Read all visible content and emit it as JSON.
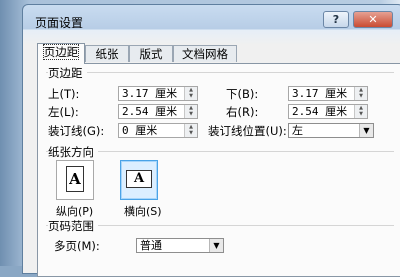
{
  "dialog": {
    "title": "页面设置",
    "help_glyph": "?",
    "close_glyph": "✕"
  },
  "tabs": [
    {
      "label": "页边距",
      "active": true
    },
    {
      "label": "纸张",
      "active": false
    },
    {
      "label": "版式",
      "active": false
    },
    {
      "label": "文档网格",
      "active": false
    }
  ],
  "margins": {
    "section_label": "页边距",
    "top": {
      "label": "上(T):",
      "value": "3.17 厘米"
    },
    "bottom": {
      "label": "下(B):",
      "value": "3.17 厘米"
    },
    "left": {
      "label": "左(L):",
      "value": "2.54 厘米"
    },
    "right": {
      "label": "右(R):",
      "value": "2.54 厘米"
    },
    "gutter": {
      "label": "装订线(G):",
      "value": "0 厘米"
    },
    "gutter_position": {
      "label": "装订线位置(U):",
      "value": "左"
    }
  },
  "orientation": {
    "section_label": "纸张方向",
    "portrait": {
      "label": "纵向(P)",
      "glyph": "A",
      "selected": false
    },
    "landscape": {
      "label": "横向(S)",
      "glyph": "A",
      "selected": true
    }
  },
  "pages": {
    "section_label": "页码范围",
    "multiple": {
      "label": "多页(M):",
      "value": "普通"
    }
  }
}
